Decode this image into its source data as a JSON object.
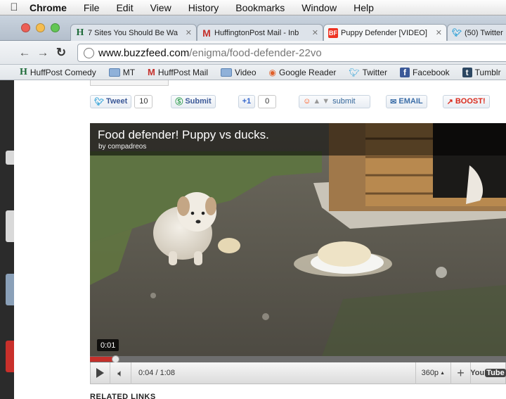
{
  "menubar": {
    "app_name": "Chrome",
    "items": [
      "File",
      "Edit",
      "View",
      "History",
      "Bookmarks",
      "Window",
      "Help"
    ]
  },
  "tabs": [
    {
      "favicon": "H",
      "label": "7 Sites You Should Be Wa"
    },
    {
      "favicon": "M",
      "label": "HuffingtonPost Mail - Inb"
    },
    {
      "favicon": "BF",
      "label": "Puppy Defender [VIDEO]",
      "active": true
    },
    {
      "favicon": "twitter-bird",
      "label": "(50) Twitter"
    }
  ],
  "toolbar": {
    "url_domain": "www.buzzfeed.com",
    "url_path": "/enigma/food-defender-22vo"
  },
  "bookmarks": [
    {
      "icon": "H",
      "label": "HuffPost Comedy"
    },
    {
      "icon": "folder",
      "label": "MT"
    },
    {
      "icon": "M",
      "label": "HuffPost Mail"
    },
    {
      "icon": "folder",
      "label": "Video"
    },
    {
      "icon": "google-reader",
      "label": "Google Reader"
    },
    {
      "icon": "twitter-bird",
      "label": "Twitter"
    },
    {
      "icon": "f",
      "label": "Facebook"
    },
    {
      "icon": "t",
      "label": "Tumblr"
    }
  ],
  "share": {
    "tweet_label": "Tweet",
    "tweet_count": "10",
    "stumble_label": "Submit",
    "plusone_label": "+1",
    "plusone_count": "0",
    "reddit_label": "submit",
    "email_label": "EMAIL",
    "boost_label": "BOOST!"
  },
  "video": {
    "title": "Food defender! Puppy vs ducks.",
    "byline": "by compadreos",
    "hover_time": "0:01",
    "time_display": "0:04 / 1:08",
    "quality": "360p",
    "progress_fraction": 0.06,
    "logo_you": "You",
    "logo_tube": "Tube"
  },
  "page": {
    "related_heading": "RELATED LINKS"
  },
  "colors": {
    "progress_red": "#c4302b",
    "menubar": "#ececec"
  }
}
